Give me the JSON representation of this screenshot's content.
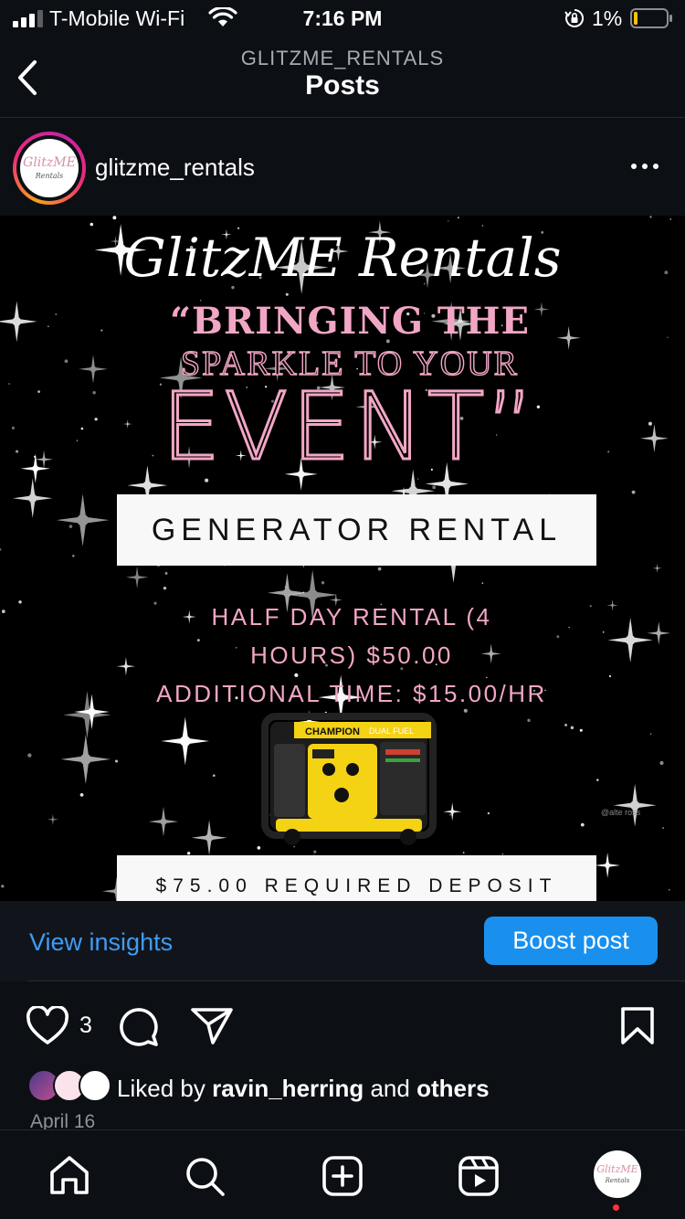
{
  "status_bar": {
    "carrier": "T-Mobile Wi-Fi",
    "time": "7:16 PM",
    "battery_percent": "1%",
    "battery_level": 0.01
  },
  "header": {
    "account": "GLITZME_RENTALS",
    "title": "Posts"
  },
  "post": {
    "username": "glitzme_rentals",
    "avatar_logo": "GlitzME",
    "avatar_logo_sub": "Rentals",
    "flyer": {
      "brand": "GlitzME Rentals",
      "tagline_1": "“BRINGING THE",
      "tagline_2": "SPARKLE TO YOUR",
      "tagline_3": "EVENT”",
      "service": "GENERATOR RENTAL",
      "price_line_1": "HALF DAY RENTAL (4",
      "price_line_2": "HOURS) $50.00",
      "price_line_3": "ADDITIONAL TIME: $15.00/HR",
      "generator_brand": "CHAMPION",
      "generator_model": "DUAL FUEL",
      "credit": "@alte   ross",
      "deposit": "$75.00 REQUIRED DEPOSIT"
    }
  },
  "insights": {
    "view_label": "View insights",
    "boost_label": "Boost post"
  },
  "actions": {
    "like_count": "3"
  },
  "likes": {
    "prefix": "Liked by ",
    "user": "ravin_herring",
    "middle": " and ",
    "others": "others"
  },
  "date": "April 16",
  "colors": {
    "accent": "#1990ee",
    "link": "#3f9bf5",
    "flyer_pink": "#f2a6c5",
    "notification": "#ff3040"
  },
  "icons": [
    "signal-icon",
    "wifi-icon",
    "orientation-lock-icon",
    "battery-icon",
    "back-arrow-icon",
    "more-options-icon",
    "heart-icon",
    "comment-icon",
    "share-icon",
    "bookmark-icon",
    "home-icon",
    "search-icon",
    "create-icon",
    "reels-icon"
  ]
}
